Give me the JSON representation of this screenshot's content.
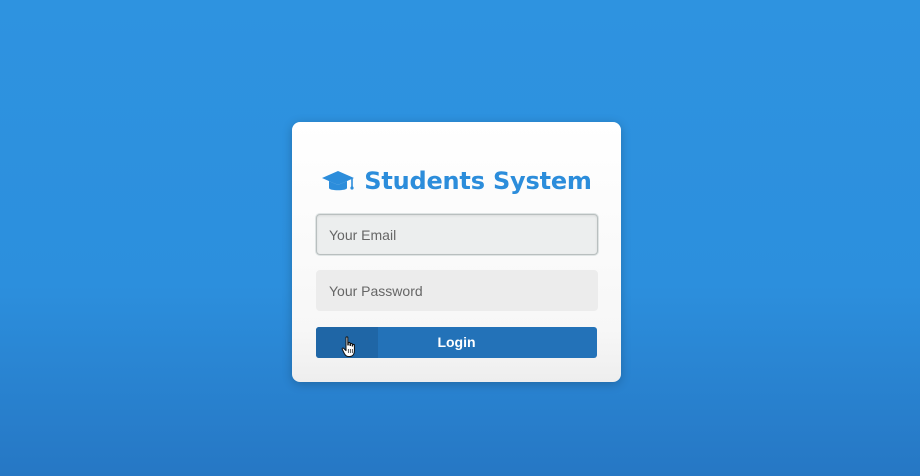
{
  "brand": {
    "title": "Students System",
    "icon": "graduation-cap-icon",
    "color": "#2c8ddb"
  },
  "form": {
    "email_placeholder": "Your Email",
    "password_placeholder": "Your Password",
    "login_label": "Login"
  },
  "colors": {
    "background": "#2e93e0",
    "button": "#2372b8",
    "card": "#ffffff"
  },
  "cursor": {
    "icon": "hand-pointer-icon"
  }
}
